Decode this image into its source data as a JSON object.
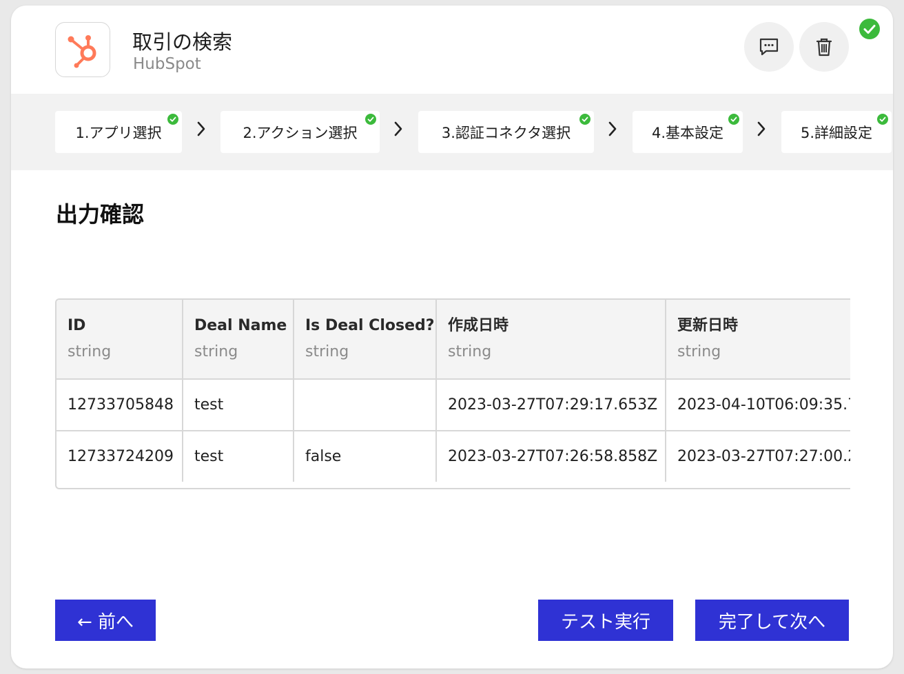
{
  "app": {
    "title": "取引の検索",
    "subtitle": "HubSpot",
    "icon": "hubspot-logo-icon",
    "brand_color": "#ff7a59"
  },
  "header_actions": {
    "comment_icon": "comment-icon",
    "delete_icon": "trash-icon",
    "status_icon": "check-circle-icon",
    "status_color": "#3cba3c"
  },
  "steps": [
    {
      "label": "1.アプリ選択",
      "completed": true
    },
    {
      "label": "2.アクション選択",
      "completed": true
    },
    {
      "label": "3.認証コネクタ選択",
      "completed": true
    },
    {
      "label": "4.基本設定",
      "completed": true
    },
    {
      "label": "5.詳細設定",
      "completed": true
    }
  ],
  "section": {
    "title": "出力確認"
  },
  "table": {
    "columns": [
      {
        "name": "ID",
        "type": "string"
      },
      {
        "name": "Deal Name",
        "type": "string"
      },
      {
        "name": "Is Deal Closed?",
        "type": "string"
      },
      {
        "name": "作成日時",
        "type": "string"
      },
      {
        "name": "更新日時",
        "type": "string"
      }
    ],
    "rows": [
      [
        "12733705848",
        "test",
        "",
        "2023-03-27T07:29:17.653Z",
        "2023-04-10T06:09:35.7"
      ],
      [
        "12733724209",
        "test",
        "false",
        "2023-03-27T07:26:58.858Z",
        "2023-03-27T07:27:00.2"
      ]
    ]
  },
  "footer": {
    "back_label": "← 前へ",
    "test_label": "テスト実行",
    "complete_label": "完了して次へ",
    "button_color": "#2f32d4"
  }
}
